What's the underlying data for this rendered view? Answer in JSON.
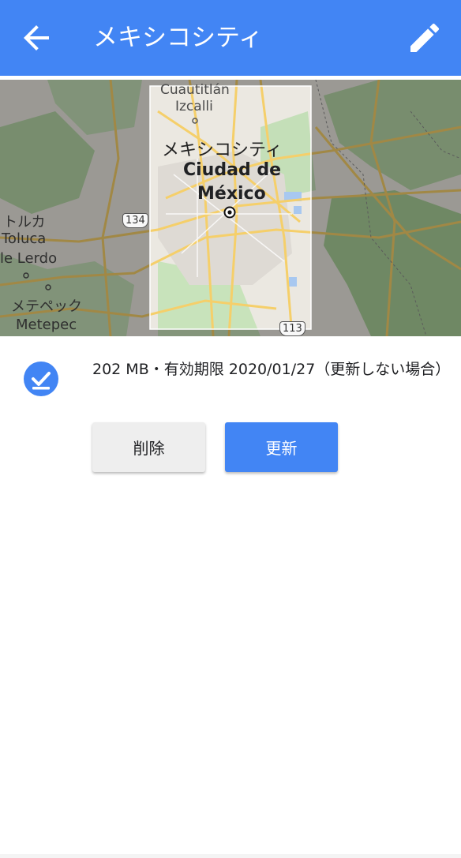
{
  "header": {
    "title": "メキシコシティ",
    "back_icon": "arrow-back-icon",
    "edit_icon": "pencil-icon"
  },
  "map": {
    "labels": {
      "cuautitlan": "Cuautitlán",
      "izcalli": "Izcalli",
      "city_jp": "メキシコシティ",
      "city_es_1": "Ciudad de",
      "city_es_2": "México",
      "toluca_jp": "トルカ",
      "toluca": "Toluca",
      "lerdo": "le Lerdo",
      "metepec_jp": "メテペック",
      "metepec": "Metepec"
    },
    "shields": {
      "route_134": "134",
      "route_113": "113"
    }
  },
  "info": {
    "status_icon": "download-done-icon",
    "text": "202 MB・有効期限 2020/01/27（更新しない場合）"
  },
  "actions": {
    "delete_label": "削除",
    "update_label": "更新"
  },
  "colors": {
    "primary": "#4285f4",
    "button_light": "#eeeeee"
  }
}
